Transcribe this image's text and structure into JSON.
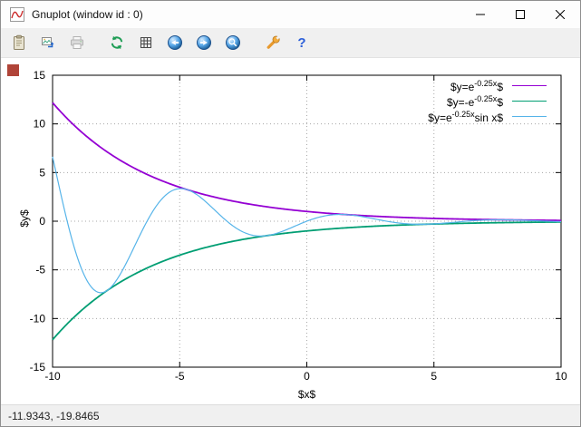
{
  "window": {
    "title": "Gnuplot (window id : 0)",
    "icon": "gnuplot-logo-icon",
    "controls": [
      "minimize",
      "maximize",
      "close"
    ]
  },
  "toolbar": {
    "help_glyph": "?",
    "buttons": [
      {
        "name": "copy-to-clipboard",
        "icon": "clipboard-icon"
      },
      {
        "name": "save-image",
        "icon": "export-image-icon"
      },
      {
        "name": "print",
        "icon": "printer-icon",
        "disabled": true
      },
      {
        "name": "replot",
        "icon": "refresh-icon"
      },
      {
        "name": "toggle-grid",
        "icon": "grid-icon"
      },
      {
        "name": "zoom-previous",
        "icon": "zoom-previous-icon"
      },
      {
        "name": "zoom-next",
        "icon": "zoom-next-icon"
      },
      {
        "name": "autoscale",
        "icon": "autoscale-icon"
      },
      {
        "name": "configure",
        "icon": "wrench-icon"
      },
      {
        "name": "help",
        "icon": "help-icon"
      }
    ]
  },
  "canvas": {
    "marker_color": "#b04438"
  },
  "statusbar": {
    "coordinates": "-11.9343, -19.8465"
  },
  "chart_data": {
    "type": "line",
    "title": "",
    "xlabel": "$x$",
    "ylabel": "$y$",
    "xlim": [
      -10,
      10
    ],
    "ylim": [
      -15,
      15
    ],
    "xticks": [
      -10,
      -5,
      0,
      5,
      10
    ],
    "yticks": [
      -15,
      -10,
      -5,
      0,
      5,
      10,
      15
    ],
    "grid": true,
    "legend_position": "top-right",
    "decay_rate": -0.25,
    "sample_points": {
      "x_start": -10,
      "x_end": 10,
      "x_step": 0.05
    },
    "series": [
      {
        "label": "$y=e^{-0.25x}$",
        "label_parts": {
          "prefix": "$y=e",
          "sup": "-0.25x",
          "suffix": "$"
        },
        "expression": "y = exp(-0.25*x)",
        "sign": 1,
        "sin_modulated": false,
        "color": "#9400d3",
        "line_width": 1.8
      },
      {
        "label": "$y=-e^{-0.25x}$",
        "label_parts": {
          "prefix": "$y=-e",
          "sup": "-0.25x",
          "suffix": "$"
        },
        "expression": "y = -exp(-0.25*x)",
        "sign": -1,
        "sin_modulated": false,
        "color": "#009e73",
        "line_width": 1.8
      },
      {
        "label": "$y=e^{-0.25x}sin x$",
        "label_parts": {
          "prefix": "$y=e",
          "sup": "-0.25x",
          "suffix": "sin x$"
        },
        "expression": "y = exp(-0.25*x)*sin(x)",
        "sign": 1,
        "sin_modulated": true,
        "color": "#56b4e9",
        "line_width": 1.2
      }
    ]
  }
}
